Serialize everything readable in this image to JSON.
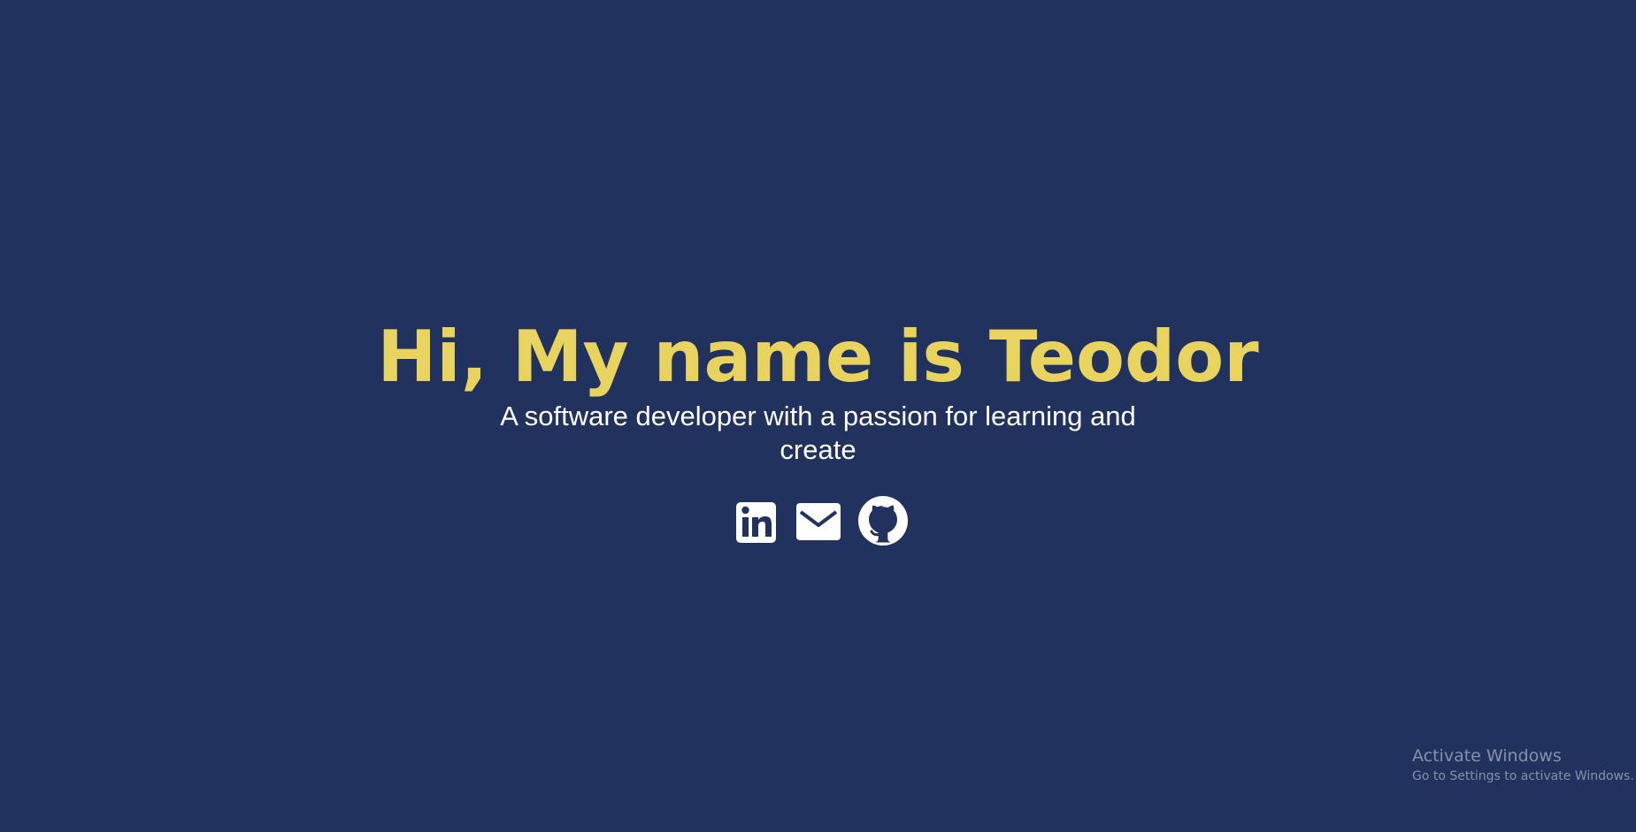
{
  "hero": {
    "title": "Hi, My name is Teodor",
    "subtitle": "A software developer with a passion for learning and create"
  },
  "socials": [
    {
      "name": "LinkedIn",
      "icon": "linkedin-icon"
    },
    {
      "name": "Email",
      "icon": "mail-icon"
    },
    {
      "name": "GitHub",
      "icon": "github-icon"
    }
  ],
  "watermark": {
    "title": "Activate Windows",
    "subtitle": "Go to Settings to activate Windows."
  },
  "colors": {
    "background": "#22325e",
    "title": "#e8d35e",
    "subtitle": "#ffffff",
    "icons": "#ffffff",
    "watermark": "#8590ab"
  }
}
